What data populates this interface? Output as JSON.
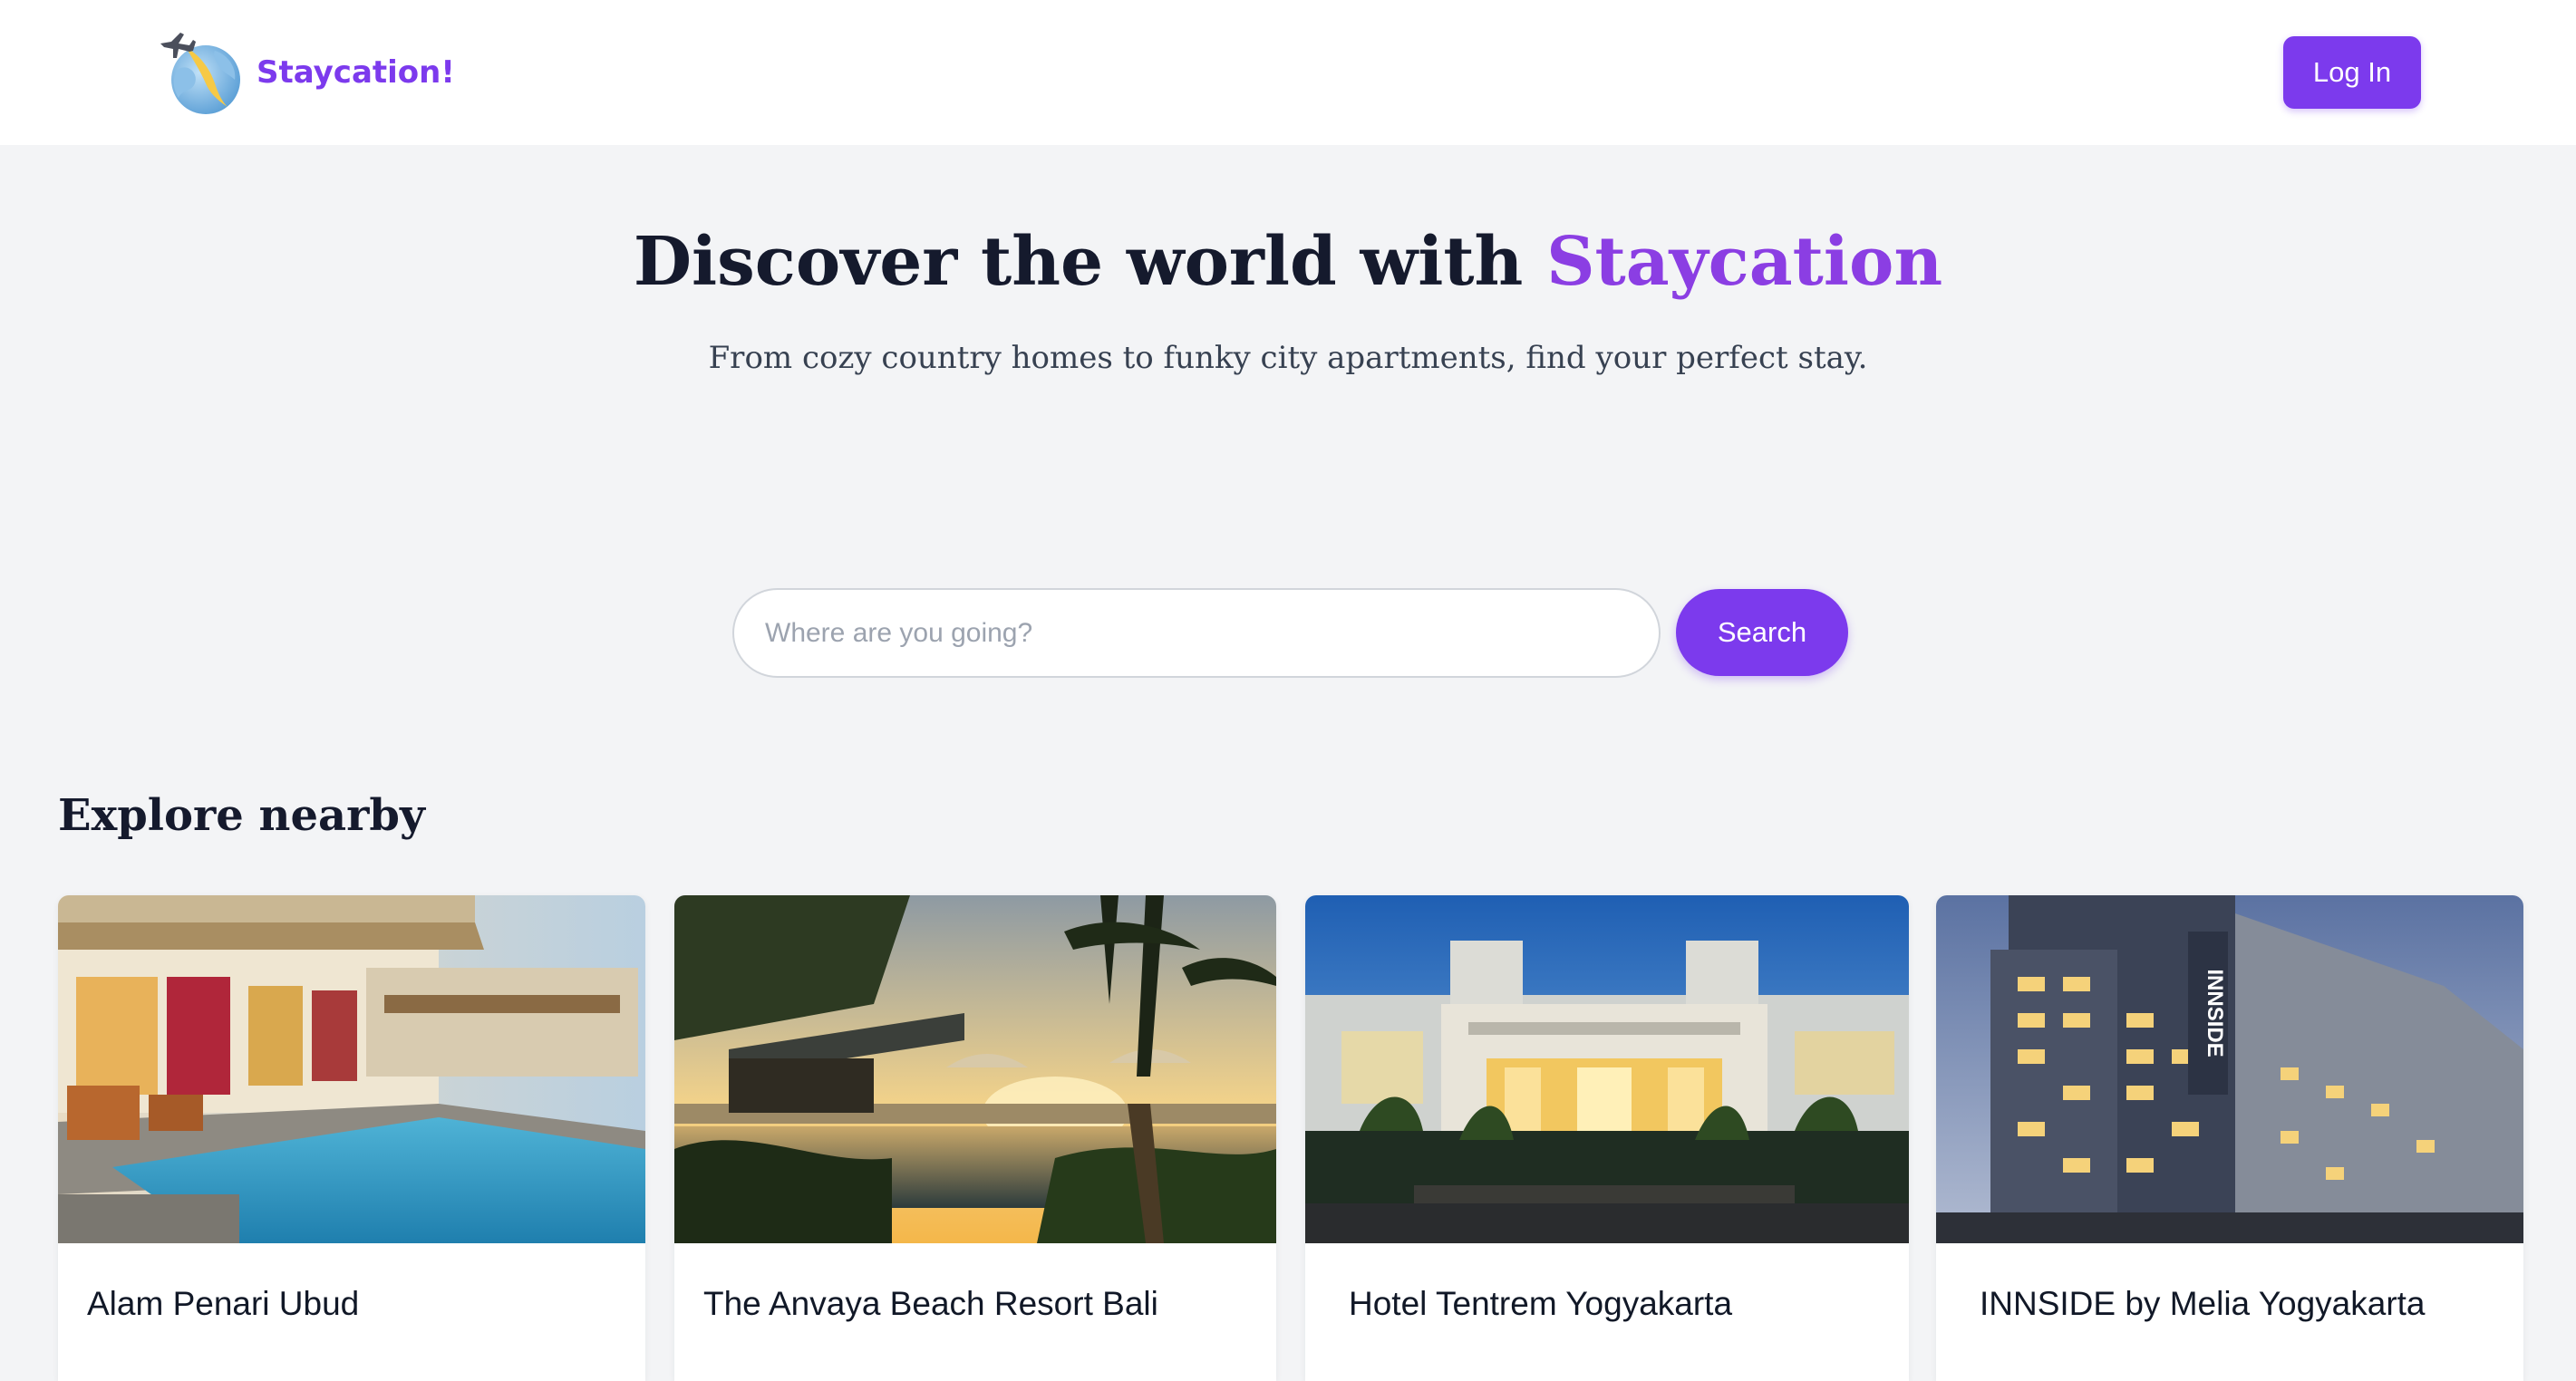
{
  "navbar": {
    "brand_name": "Staycation!",
    "logo_icon": "globe-plane-logo",
    "login_label": "Log In"
  },
  "hero": {
    "title_prefix": "Discover the world with",
    "title_accent": "Staycation",
    "subtitle": "From cozy country homes to funky city apartments, find your perfect stay."
  },
  "search": {
    "placeholder": "Where are you going?",
    "value": "",
    "button_label": "Search"
  },
  "explore": {
    "title": "Explore nearby",
    "cards": [
      {
        "name": "Alam Penari Ubud",
        "image": "resort-pool-photo"
      },
      {
        "name": "The Anvaya Beach Resort Bali",
        "image": "beach-sunset-pool-photo"
      },
      {
        "name": "Hotel Tentrem Yogyakarta",
        "image": "hotel-facade-dusk-photo"
      },
      {
        "name": "INNSIDE by Melia Yogyakarta",
        "image": "hotel-tower-evening-photo",
        "sign_text": "INNSIDE"
      }
    ]
  },
  "colors": {
    "brand": "#7c3aed",
    "hero_accent": "#8b3ee3",
    "heading": "#151a2d",
    "page_bg": "#f3f4f6"
  }
}
